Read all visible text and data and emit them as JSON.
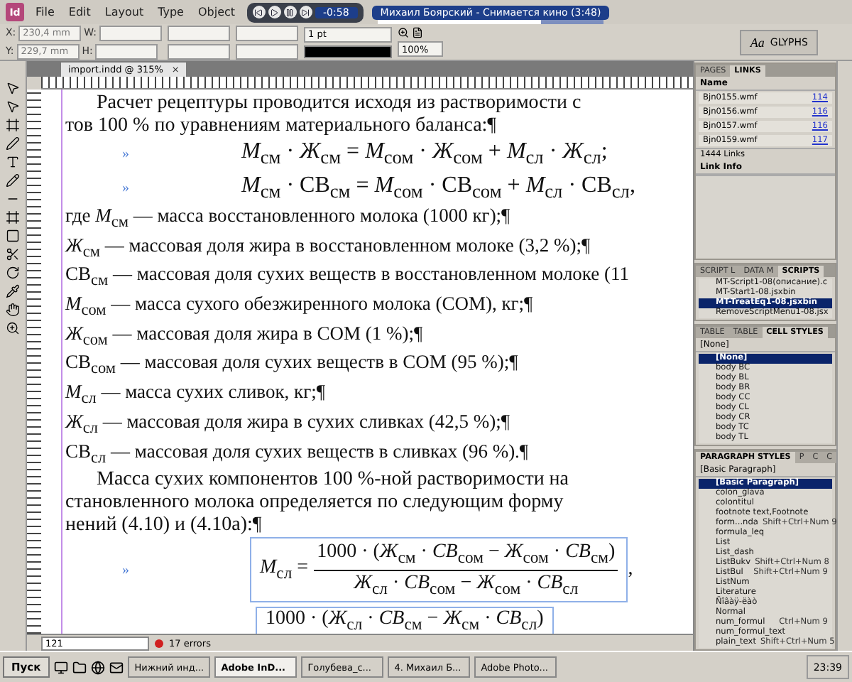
{
  "menu_bar": {
    "logo": "Id",
    "menus": [
      "File",
      "Edit",
      "Layout",
      "Type",
      "Object"
    ]
  },
  "media_player": {
    "time": "-0:58",
    "track": "Михаил Боярский - Снимается кино (3:48)",
    "position": {
      "level": 0.72
    }
  },
  "control_bar": {
    "x_label": "X:",
    "x": "230,4 mm",
    "y_label": "Y:",
    "y": "229,7 mm",
    "w_label": "W:",
    "h_label": "H:",
    "stroke": "1 pt",
    "scale": "100%"
  },
  "glyphs_panel": {
    "icon_text": "Aa",
    "title": "GLYPHS"
  },
  "document_tab": {
    "title": "import.indd @ 315%",
    "close": "×"
  },
  "document": {
    "blocks": [
      {
        "kind": "paragraph",
        "lines": [
          "Расчет рецептуры проводится исходя из растворимости с",
          "тов 100 % по уравнениям материального баланса:¶"
        ]
      },
      {
        "kind": "formula",
        "marker": "»",
        "text": "*М*$_{см}$ · *Ж*$_{см}$ = *М*$_{сом}$ · *Ж*$_{сом}$ + *М*$_{сл}$ · *Ж*$_{сл}$;"
      },
      {
        "kind": "formula",
        "marker": "»",
        "text": "*М*$_{см}$ · СВ$_{см}$ = *М*$_{сом}$ · СВ$_{сом}$ + *М*$_{сл}$ · СВ$_{сл}$,"
      },
      {
        "kind": "definitions",
        "lines": [
          "где *М*$_{см}$ — масса восстановленного молока (1000 кг);¶",
          "*Ж*$_{см}$ — массовая доля жира в восстановленном молоке (3,2 %);¶",
          "СВ$_{см}$ — массовая доля сухих веществ в восстановленном молоке (11",
          "*М*$_{сом}$ — масса сухого обезжиренного молока (СОМ), кг;¶",
          "*Ж*$_{сом}$ — массовая доля жира в СОМ (1 %);¶",
          "СВ$_{сом}$ — массовая доля сухих веществ в СОМ (95 %);¶",
          "*М*$_{сл}$ — масса сухих сливок, кг;¶",
          "*Ж*$_{сл}$ — массовая доля жира в сухих сливках (42,5 %);¶",
          "СВ$_{сл}$ — массовая доля сухих веществ в сливках (96 %).¶"
        ]
      },
      {
        "kind": "paragraph",
        "lines": [
          "Масса сухих компонентов 100 %-ной растворимости на",
          "становленного молока определяется по следующим форму",
          "нений (4.10) и (4.10a):¶"
        ]
      },
      {
        "kind": "fraction",
        "marker": "»",
        "lhs": "*М*$_{сл}$ =",
        "numerator": "1000 · (*Ж*$_{см}$ · *СВ*$_{сом}$ − *Ж*$_{сом}$ · *СВ*$_{см}$)",
        "denominator": "*Ж*$_{сл}$ · *СВ*$_{сом}$ − *Ж*$_{сом}$ · *СВ*$_{сл}$",
        "tail": ","
      },
      {
        "kind": "partial_fraction",
        "numerator": "1000 · (*Ж*$_{сл}$ · *СВ*$_{см}$ − *Ж*$_{см}$ · *СВ*$_{сл}$)"
      }
    ]
  },
  "status_bar": {
    "page": "121",
    "errors": "17 errors"
  },
  "links_panel": {
    "tabs": [
      {
        "label": "PAGES",
        "selected": false
      },
      {
        "label": "LINKS",
        "selected": true
      }
    ],
    "header": "Name",
    "rows": [
      {
        "name": "Bjn0155.wmf",
        "page": "114"
      },
      {
        "name": "Bjn0156.wmf",
        "page": "116"
      },
      {
        "name": "Bjn0157.wmf",
        "page": "116"
      },
      {
        "name": "Bjn0159.wmf",
        "page": "117"
      }
    ],
    "count": "1444 Links",
    "info_title": "Link Info"
  },
  "scripts_panel": {
    "tabs": [
      {
        "label": "SCRIPT L",
        "selected": false
      },
      {
        "label": "DATA M",
        "selected": false
      },
      {
        "label": "SCRIPTS",
        "selected": true
      }
    ],
    "items": [
      {
        "name": "MT-Script1-08(описание).c",
        "selected": false
      },
      {
        "name": "MT-Start1-08.jsxbin",
        "selected": false
      },
      {
        "name": "MT-TreatEq1-08.jsxbin",
        "selected": true
      },
      {
        "name": "RemoveScriptMenu1-08.jsx",
        "selected": false
      }
    ]
  },
  "cell_styles_panel": {
    "tabs": [
      {
        "label": "TABLE",
        "selected": false
      },
      {
        "label": "TABLE",
        "selected": false
      },
      {
        "label": "CELL STYLES",
        "selected": true
      }
    ],
    "current": "[None]",
    "items": [
      {
        "name": "[None]",
        "selected": true
      },
      {
        "name": "body BC",
        "selected": false
      },
      {
        "name": "body BL",
        "selected": false
      },
      {
        "name": "body BR",
        "selected": false
      },
      {
        "name": "body CC",
        "selected": false
      },
      {
        "name": "body CL",
        "selected": false
      },
      {
        "name": "body CR",
        "selected": false
      },
      {
        "name": "body TC",
        "selected": false
      },
      {
        "name": "body TL",
        "selected": false
      }
    ]
  },
  "paragraph_styles_panel": {
    "tabs": [
      {
        "label": "PARAGRAPH STYLES",
        "selected": true
      },
      {
        "label": "P",
        "selected": false
      },
      {
        "label": "C",
        "selected": false
      },
      {
        "label": "C",
        "selected": false
      }
    ],
    "current": "[Basic Paragraph]",
    "items": [
      {
        "name": "[Basic Paragraph]",
        "selected": true
      },
      {
        "name": "colon_glava",
        "selected": false
      },
      {
        "name": "colontitul",
        "selected": false
      },
      {
        "name": "footnote text,Footnote",
        "selected": false
      },
      {
        "name": "form...nda",
        "shortcut": "Shift+Ctrl+Num 9",
        "selected": false
      },
      {
        "name": "formula_leq",
        "selected": false
      },
      {
        "name": "List",
        "selected": false
      },
      {
        "name": "List_dash",
        "selected": false
      },
      {
        "name": "ListBukv",
        "shortcut": "Shift+Ctrl+Num 8",
        "selected": false
      },
      {
        "name": "ListBul",
        "shortcut": "Shift+Ctrl+Num 9",
        "selected": false
      },
      {
        "name": "ListNum",
        "selected": false
      },
      {
        "name": "Literature",
        "selected": false
      },
      {
        "name": "Ñîâàÿ-ëàò",
        "selected": false
      },
      {
        "name": "Normal",
        "selected": false
      },
      {
        "name": "num_formul",
        "shortcut": "Ctrl+Num 9",
        "selected": false
      },
      {
        "name": "num_formul_text",
        "selected": false
      },
      {
        "name": "plain_text",
        "shortcut": "Shift+Ctrl+Num 5",
        "selected": false
      }
    ]
  },
  "taskbar": {
    "start": "Пуск",
    "tasks": [
      {
        "label": "Нижний инд...",
        "selected": false
      },
      {
        "label": "Adobe InD...",
        "selected": true
      },
      {
        "label": "Голубева_с...",
        "selected": false
      },
      {
        "label": "4. Михаил Б...",
        "selected": false
      },
      {
        "label": "Adobe Photo...",
        "selected": false
      }
    ],
    "clock": "23:39"
  }
}
